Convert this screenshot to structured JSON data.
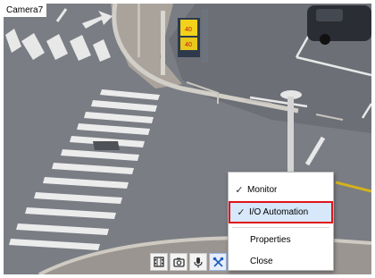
{
  "camera": {
    "name": "Camera7"
  },
  "toolbar": {
    "buttons": [
      {
        "icon": "film-strip-icon"
      },
      {
        "icon": "camera-snapshot-icon"
      },
      {
        "icon": "microphone-icon"
      },
      {
        "icon": "tools-icon"
      }
    ]
  },
  "context_menu": {
    "items": [
      {
        "label": "Monitor",
        "checked": true
      },
      {
        "label": "I/O Automation",
        "checked": true,
        "highlighted": true
      },
      {
        "label": "Properties",
        "checked": false
      },
      {
        "label": "Close",
        "checked": false
      }
    ],
    "highlight_color": "#e0141b",
    "hover_color": "#d7e8fb"
  },
  "sign": {
    "speed_top": "40",
    "speed_bottom": "40"
  }
}
